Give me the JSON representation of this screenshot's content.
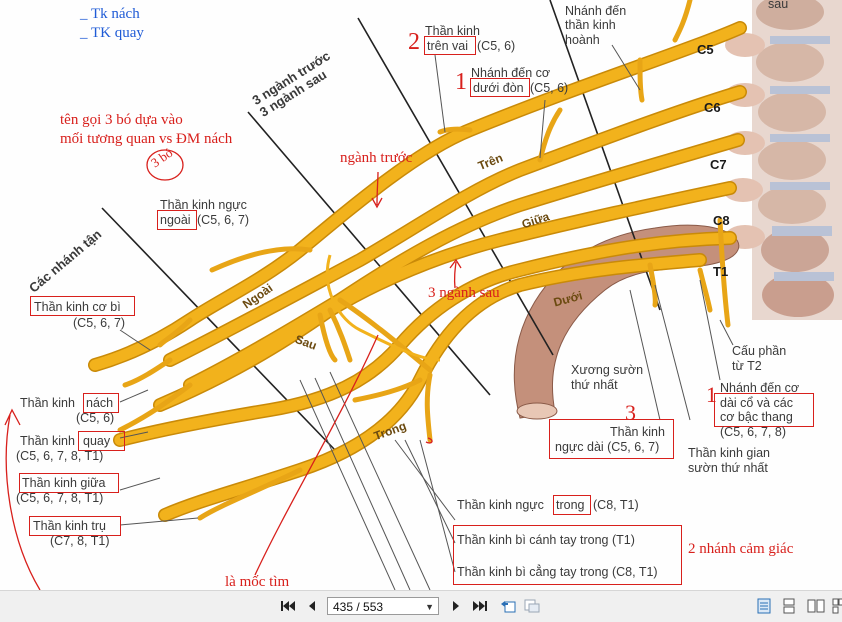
{
  "notes_blue": [
    "_ Tk nách",
    "_ TK quay"
  ],
  "notes_red": {
    "cords_naming_line1": "tên gọi 3 bó dựa vào",
    "cords_naming_line2": "mối tương quan vs ĐM nách",
    "three_cords": "3 bó",
    "anterior_branch": "ngành trước",
    "posterior_three": "3 ngành sau",
    "landmark": "là mốc tìm",
    "two_sensory": "2 nhánh cảm giác",
    "mark_2": "2",
    "mark_1": "1",
    "mark_3": "3",
    "mark_1b": "1"
  },
  "section_labels": {
    "divisions": "3 ngành trước\n3 ngành sau",
    "terminal": "Các nhánh tận"
  },
  "trunks": [
    "Trên",
    "Giữa",
    "Dưới"
  ],
  "cords": [
    "Ngoài",
    "Sau",
    "Trong"
  ],
  "roots": [
    "C5",
    "C6",
    "C7",
    "C8",
    "T1"
  ],
  "labels": {
    "suprascapular_1": "Thần kinh",
    "suprascapular_2": "trên vai",
    "suprascapular_3": "(C5, 6)",
    "subclavius_1": "Nhánh đến cơ",
    "subclavius_2": "dưới đòn",
    "subclavius_3": "(C5, 6)",
    "phrenic_1": "Nhánh đến",
    "phrenic_2": "thần kinh",
    "phrenic_3": "hoành",
    "top_right": "sau",
    "lateral_pectoral_1": "Thần kinh ngực",
    "lateral_pectoral_2": "ngoài",
    "lateral_pectoral_3": "(C5, 6, 7)",
    "musculocutaneous_1": "Thần kinh cơ bì",
    "musculocutaneous_2": "(C5, 6, 7)",
    "axillary_1": "Thần kinh",
    "axillary_2": "nách",
    "axillary_3": "(C5, 6)",
    "radial_1": "Thần kinh",
    "radial_2": "quay",
    "radial_3": "(C5, 6, 7, 8, T1)",
    "median_1": "Thần kinh giữa",
    "median_2": "(C5, 6, 7, 8, T1)",
    "ulnar_1": "Thần kinh trụ",
    "ulnar_2": "(C7, 8, T1)",
    "first_rib_1": "Xương sườn",
    "first_rib_2": "thứ nhất",
    "long_thoracic_1": "Thần kinh",
    "long_thoracic_2": "ngực dài (C5, 6, 7)",
    "intercosto_1": "Thần kinh gian",
    "intercosto_2": "sườn thứ nhất",
    "t2_1": "Cấu phần",
    "t2_2": "từ T2",
    "longus_1": "Nhánh đến cơ",
    "longus_2": "dài cổ và các",
    "longus_3": "cơ bậc thang",
    "longus_4": "(C5, 6, 7, 8)",
    "medial_pectoral_1": "Thần kinh ngực",
    "medial_pectoral_2": "trong",
    "medial_pectoral_3": "(C8, T1)",
    "med_brachial": "Thần kinh bì cánh tay trong (T1)",
    "med_antebrachial": "Thần kinh bì cẳng tay trong (C8, T1)"
  },
  "toolbar": {
    "page_value": "435 / 553"
  },
  "colors": {
    "nerve": "#f2b21c",
    "nerve_edge": "#c98a08",
    "annotation_red": "#d8201c",
    "annotation_blue": "#1f5bd6"
  }
}
